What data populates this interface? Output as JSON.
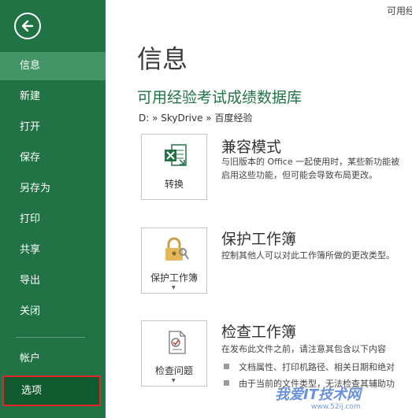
{
  "sidebar": {
    "items": [
      {
        "label": "信息"
      },
      {
        "label": "新建"
      },
      {
        "label": "打开"
      },
      {
        "label": "保存"
      },
      {
        "label": "另存为"
      },
      {
        "label": "打印"
      },
      {
        "label": "共享"
      },
      {
        "label": "导出"
      },
      {
        "label": "关闭"
      },
      {
        "label": "帐户"
      },
      {
        "label": "选项"
      }
    ]
  },
  "header": {
    "top_right": "可用经"
  },
  "main": {
    "title": "信息",
    "doc_name": "可用经验考试成绩数据库",
    "breadcrumb": "D: » SkyDrive » 百度经验",
    "sections": [
      {
        "button": "转换",
        "title": "兼容模式",
        "lines": [
          "与旧版本的 Office 一起使用时，某些新功能被",
          "启用这些功能，但可能会导致布局更改。"
        ]
      },
      {
        "button": "保护工作簿",
        "title": "保护工作簿",
        "lines": [
          "控制其他人可以对此工作簿所做的更改类型。"
        ]
      },
      {
        "button": "检查问题",
        "title": "检查工作簿",
        "lines": [
          "在发布此文件之前，请注意其包含以下内容"
        ],
        "bullets": [
          "文档属性、打印机路径、相关日期和绝对",
          "由于当前的文件类型，无法检查其辅助功"
        ]
      }
    ]
  },
  "watermark": {
    "text": "我爱IT技术网",
    "sub": "www.52ij.com"
  },
  "colors": {
    "sidebar": "#217346",
    "active": "#439467",
    "selected": "#0f5a2f",
    "highlight_border": "#e8232a"
  }
}
